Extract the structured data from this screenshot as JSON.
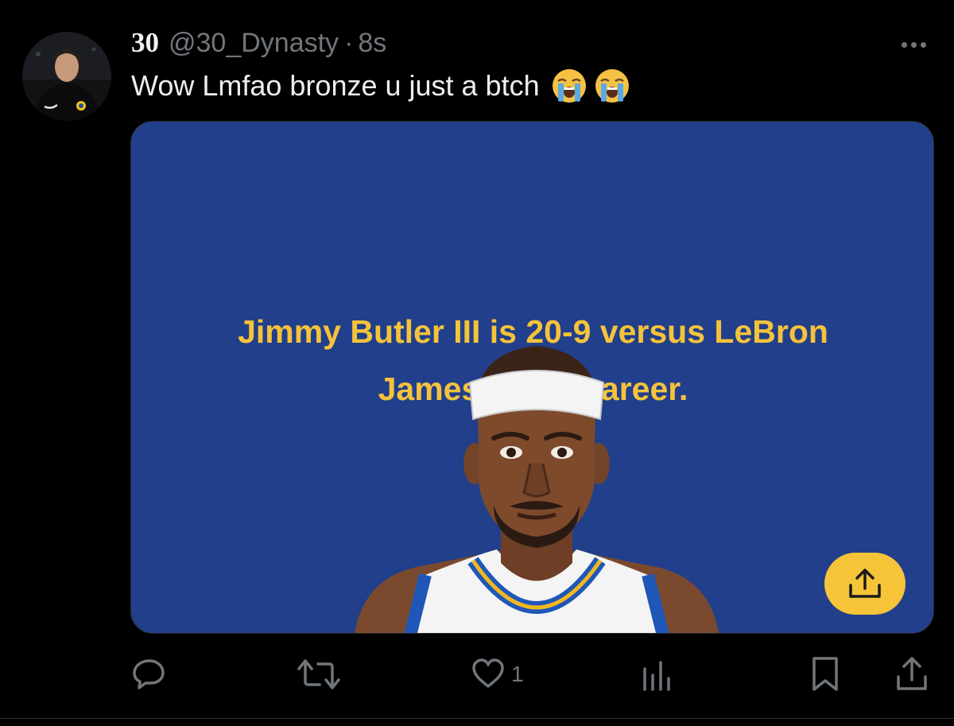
{
  "author": {
    "display_name": "30",
    "handle": "@30_Dynasty",
    "separator": "·",
    "time": "8s"
  },
  "tweet": {
    "text": "Wow Lmfao bronze u just a btch",
    "emojis": [
      "loudly-crying-face-emoji",
      "loudly-crying-face-emoji"
    ]
  },
  "media": {
    "headline_line1": "Jimmy Butler III is 20-9 versus LeBron",
    "headline_line2": "James in his career.",
    "background_color": "#213f8a",
    "headline_color": "#f5c33b",
    "share_button_color": "#f6c438",
    "share_icon": "share-upload-icon",
    "illustration": "cartoon basketball player with white headband and jersey"
  },
  "actions": {
    "reply_icon": "reply-icon",
    "retweet_icon": "retweet-icon",
    "like_icon": "heart-icon",
    "like_count": "1",
    "views_icon": "views-bar-chart-icon",
    "bookmark_icon": "bookmark-icon",
    "share_icon": "share-icon"
  },
  "colors": {
    "background": "#000000",
    "text_primary": "#e7e9ea",
    "text_secondary": "#71767b"
  }
}
